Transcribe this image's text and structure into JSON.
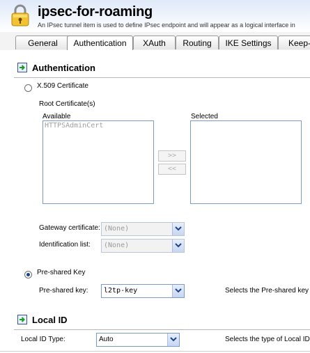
{
  "header": {
    "title": "ipsec-for-roaming",
    "subtitle": "An IPsec tunnel item is used to define IPsec endpoint and will appear as a logical interface in"
  },
  "tabs": [
    {
      "label": "General"
    },
    {
      "label": "Authentication",
      "active": true
    },
    {
      "label": "XAuth"
    },
    {
      "label": "Routing"
    },
    {
      "label": "IKE Settings"
    },
    {
      "label": "Keep-a"
    }
  ],
  "authentication": {
    "section_title": "Authentication",
    "x509_label": "X.509 Certificate",
    "root_cert_label": "Root Certificate(s)",
    "available_label": "Available",
    "selected_label": "Selected",
    "available_items": [
      "HTTPSAdminCert"
    ],
    "move_right_label": ">>",
    "move_left_label": "<<",
    "gateway_cert_label": "Gateway certificate:",
    "gateway_cert_value": "(None)",
    "identification_list_label": "Identification list:",
    "identification_list_value": "(None)",
    "psk_radio_label": "Pre-shared Key",
    "psk_label": "Pre-shared key:",
    "psk_value": "l2tp-key",
    "psk_hint": "Selects the Pre-shared key to",
    "selected_method": "Pre-shared Key"
  },
  "local_id": {
    "section_title": "Local ID",
    "type_label": "Local ID Type:",
    "type_value": "Auto",
    "type_hint": "Selects the type of Local ID"
  },
  "colors": {
    "accent": "#1d3f8a",
    "border": "#7a9ac8",
    "header_gradient_top": "#dfe9f9"
  }
}
